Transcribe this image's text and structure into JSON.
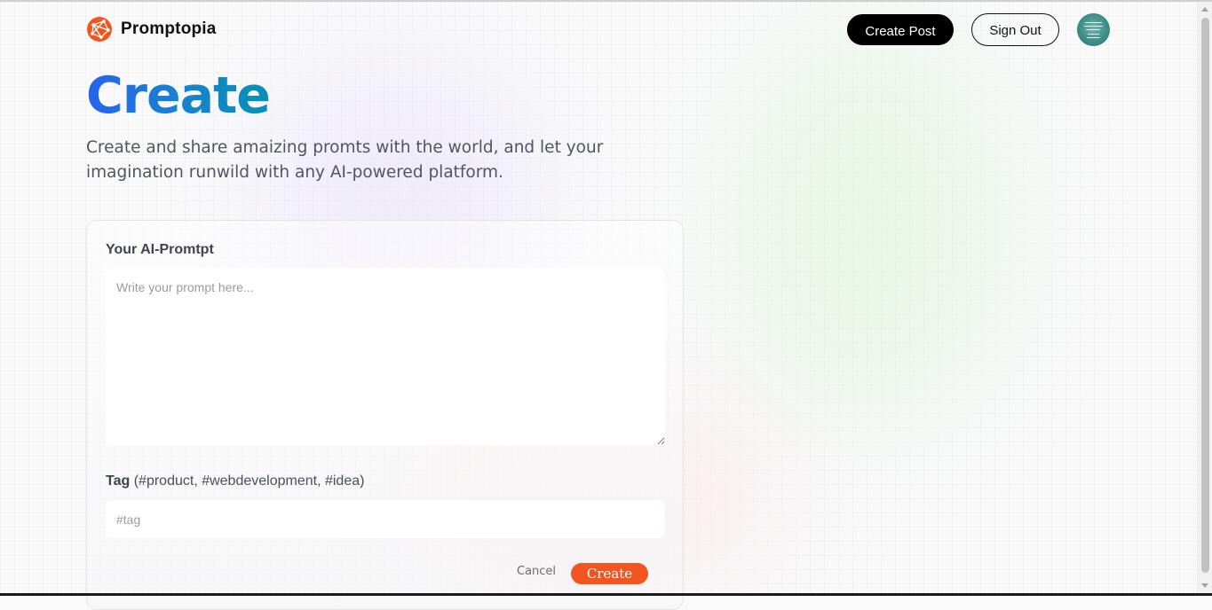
{
  "brand": {
    "name": "Promptopia",
    "logo_icon": "promptopia-logo-icon",
    "accent_color": "#f2551f"
  },
  "nav": {
    "create_post_label": "Create Post",
    "sign_out_label": "Sign Out",
    "avatar_icon": "user-avatar"
  },
  "hero": {
    "title": "Create",
    "description": "Create and share amaizing promts with the world, and let your imagination runwild with any AI-powered platform."
  },
  "form": {
    "prompt_label": "Your AI-Promtpt",
    "prompt_value": "",
    "prompt_placeholder": "Write your prompt here...",
    "tag_label": "Tag",
    "tag_hint": "(#product, #webdevelopment, #idea)",
    "tag_value": "",
    "tag_placeholder": "#tag",
    "cancel_label": "Cancel",
    "submit_label": "Create"
  }
}
